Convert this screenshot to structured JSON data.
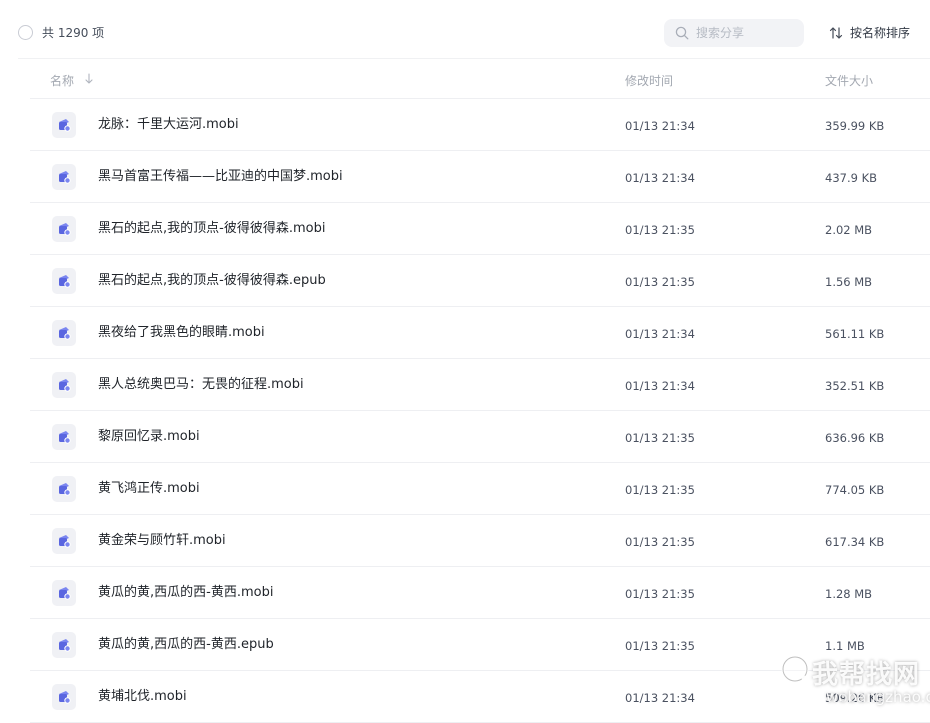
{
  "toolbar": {
    "count_label": "共 1290 项",
    "search_placeholder": "搜索分享",
    "sort_label": "按名称排序"
  },
  "columns": {
    "name": "名称",
    "time": "修改时间",
    "size": "文件大小"
  },
  "files": [
    {
      "name": "龙脉：千里大运河.mobi",
      "time": "01/13 21:34",
      "size": "359.99 KB"
    },
    {
      "name": "黑马首富王传福——比亚迪的中国梦.mobi",
      "time": "01/13 21:34",
      "size": "437.9 KB"
    },
    {
      "name": "黑石的起点,我的顶点-彼得彼得森.mobi",
      "time": "01/13 21:35",
      "size": "2.02 MB"
    },
    {
      "name": "黑石的起点,我的顶点-彼得彼得森.epub",
      "time": "01/13 21:35",
      "size": "1.56 MB"
    },
    {
      "name": "黑夜给了我黑色的眼睛.mobi",
      "time": "01/13 21:34",
      "size": "561.11 KB"
    },
    {
      "name": "黑人总统奥巴马：无畏的征程.mobi",
      "time": "01/13 21:34",
      "size": "352.51 KB"
    },
    {
      "name": "黎原回忆录.mobi",
      "time": "01/13 21:35",
      "size": "636.96 KB"
    },
    {
      "name": "黄飞鸿正传.mobi",
      "time": "01/13 21:35",
      "size": "774.05 KB"
    },
    {
      "name": "黄金荣与顾竹轩.mobi",
      "time": "01/13 21:35",
      "size": "617.34 KB"
    },
    {
      "name": "黄瓜的黄,西瓜的西-黄西.mobi",
      "time": "01/13 21:35",
      "size": "1.28 MB"
    },
    {
      "name": "黄瓜的黄,西瓜的西-黄西.epub",
      "time": "01/13 21:35",
      "size": "1.1 MB"
    },
    {
      "name": "黄埔北伐.mobi",
      "time": "01/13 21:34",
      "size": "509.26 KB"
    }
  ],
  "watermark": {
    "text": "我帮找网",
    "url": "wobangzhao.com"
  },
  "colors": {
    "file_icon_bg": "#f0f1f5",
    "file_icon_accent": "#7b86f0",
    "file_icon_accent_dark": "#5a66e0"
  }
}
